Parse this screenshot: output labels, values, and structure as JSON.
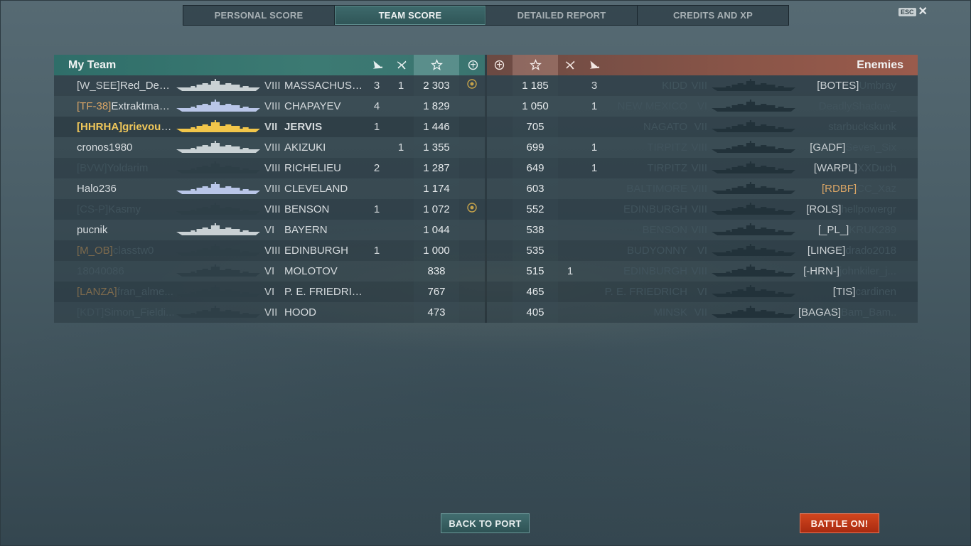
{
  "tabs": [
    {
      "label": "PERSONAL SCORE"
    },
    {
      "label": "TEAM SCORE"
    },
    {
      "label": "DETAILED REPORT"
    },
    {
      "label": "CREDITS AND XP"
    }
  ],
  "active_tab": "TEAM SCORE",
  "esc_label": "ESC",
  "close_label": "✕",
  "my_team": {
    "title": "My Team",
    "players": [
      {
        "clan": "[W_SEE]",
        "name": "Red_Devil...",
        "tier": "VIII",
        "ship": "MASSACHUSE...",
        "kills": "3",
        "planes": "1",
        "score": "2 303",
        "achievement": true,
        "alive": true
      },
      {
        "clan": "[TF-38]",
        "clan_gold": true,
        "name": "Extraktmazl...",
        "tier": "VIII",
        "ship": "CHAPAYEV",
        "kills": "4",
        "planes": "",
        "score": "1 829",
        "achievement": false,
        "alive": true
      },
      {
        "clan": "[HHRHA]",
        "name": "grievous19...",
        "tier": "VII",
        "ship": "JERVIS",
        "kills": "1",
        "planes": "",
        "score": "1 446",
        "achievement": false,
        "alive": true,
        "me": true
      },
      {
        "clan": "",
        "name": "cronos1980",
        "tier": "VIII",
        "ship": "AKIZUKI",
        "kills": "",
        "planes": "1",
        "score": "1 355",
        "achievement": false,
        "alive": true
      },
      {
        "clan": "[BVW]",
        "name": "Yoldarim",
        "tier": "VIII",
        "ship": "RICHELIEU",
        "kills": "2",
        "planes": "",
        "score": "1 287",
        "achievement": false,
        "alive": false
      },
      {
        "clan": "",
        "name": "Halo236",
        "tier": "VIII",
        "ship": "CLEVELAND",
        "kills": "",
        "planes": "",
        "score": "1 174",
        "achievement": false,
        "alive": true
      },
      {
        "clan": "[CS-P]",
        "name": "Kasmy",
        "tier": "VIII",
        "ship": "BENSON",
        "kills": "1",
        "planes": "",
        "score": "1 072",
        "achievement": true,
        "alive": false
      },
      {
        "clan": "",
        "name": "pucnik",
        "tier": "VI",
        "ship": "BAYERN",
        "kills": "",
        "planes": "",
        "score": "1 044",
        "achievement": false,
        "alive": true
      },
      {
        "clan": "[M_OB]",
        "clan_gold": true,
        "name": "classtw0",
        "tier": "VIII",
        "ship": "EDINBURGH",
        "kills": "1",
        "planes": "",
        "score": "1 000",
        "achievement": false,
        "alive": false
      },
      {
        "clan": "",
        "name": "18040086",
        "tier": "VI",
        "ship": "MOLOTOV",
        "kills": "",
        "planes": "",
        "score": "838",
        "achievement": false,
        "alive": false
      },
      {
        "clan": "[LANZA]",
        "clan_gold": true,
        "name": "fran_alme...",
        "tier": "VI",
        "ship": "P. E. FRIEDRICH",
        "kills": "",
        "planes": "",
        "score": "767",
        "achievement": false,
        "alive": false
      },
      {
        "clan": "[KDT]",
        "name": "Simon_Fieldi...",
        "tier": "VII",
        "ship": "HOOD",
        "kills": "",
        "planes": "",
        "score": "473",
        "achievement": false,
        "alive": false
      }
    ]
  },
  "enemies": {
    "title": "Enemies",
    "players": [
      {
        "clan": "[BOTES]",
        "name": "Umbray",
        "tier": "VIII",
        "ship": "KIDD",
        "kills": "3",
        "planes": "",
        "score": "1 185",
        "alive": false
      },
      {
        "clan": "",
        "name": "DeadlyShadow_",
        "tier": "VI",
        "ship": "NEW MEXICO",
        "kills": "1",
        "planes": "",
        "score": "1 050",
        "alive": false
      },
      {
        "clan": "",
        "name": "starbuckskunk",
        "tier": "VII",
        "ship": "NAGATO",
        "kills": "",
        "planes": "",
        "score": "705",
        "alive": false
      },
      {
        "clan": "[GADF]",
        "name": "Seven_Six",
        "tier": "VIII",
        "ship": "TIRPITZ",
        "kills": "1",
        "planes": "",
        "score": "699",
        "alive": false
      },
      {
        "clan": "[WARPL]",
        "name": "XXDuch",
        "tier": "VIII",
        "ship": "TIRPITZ",
        "kills": "1",
        "planes": "",
        "score": "649",
        "alive": false
      },
      {
        "clan": "[RDBF]",
        "clan_gold": true,
        "name": "CC_Xaz",
        "tier": "VIII",
        "ship": "BALTIMORE",
        "kills": "",
        "planes": "",
        "score": "603",
        "alive": false
      },
      {
        "clan": "[ROLS]",
        "name": "hellpowergr",
        "tier": "VIII",
        "ship": "EDINBURGH",
        "kills": "",
        "planes": "",
        "score": "552",
        "alive": false
      },
      {
        "clan": "[_PL_]",
        "name": "KRUK289",
        "tier": "VIII",
        "ship": "BENSON",
        "kills": "",
        "planes": "",
        "score": "538",
        "alive": false
      },
      {
        "clan": "[LINGE]",
        "name": "drado2018",
        "tier": "VI",
        "ship": "BUDYONNY",
        "kills": "",
        "planes": "",
        "score": "535",
        "alive": false
      },
      {
        "clan": "[-HRN-]",
        "name": "johnkiler_j...",
        "tier": "VIII",
        "ship": "EDINBURGH",
        "kills": "",
        "planes": "1",
        "score": "515",
        "alive": false
      },
      {
        "clan": "[TIS]",
        "name": "cardinen",
        "tier": "VI",
        "ship": "P. E. FRIEDRICH",
        "kills": "",
        "planes": "",
        "score": "465",
        "alive": false
      },
      {
        "clan": "[BAGAS]",
        "name": "Bam_Bam...",
        "tier": "VII",
        "ship": "MINSK",
        "kills": "",
        "planes": "",
        "score": "405",
        "alive": false
      }
    ]
  },
  "buttons": {
    "back_to_port": "BACK TO PORT",
    "battle_on": "BATTLE ON!"
  },
  "colors": {
    "my_team_header": "#3c7a73",
    "enemy_header": "#8a5548",
    "player_highlight": "#f0c75a",
    "clan_gold": "#d9a566",
    "battle_button": "#c33a18"
  },
  "icons": {
    "kills": "ship-kill-icon",
    "planes": "plane-kill-icon",
    "score": "star-icon",
    "achievement": "achievement-medal-icon"
  }
}
